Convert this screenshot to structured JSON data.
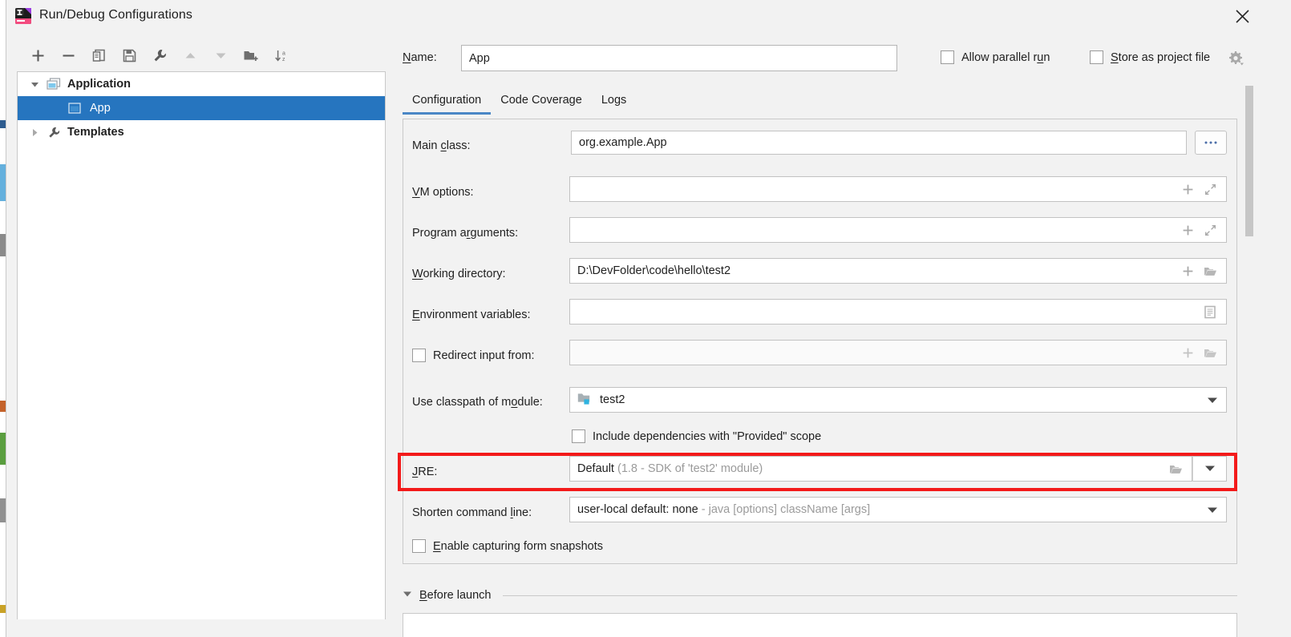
{
  "window": {
    "title": "Run/Debug Configurations",
    "app_icon": "intellij-idea-icon",
    "close_icon": "close-icon"
  },
  "toolbar": {
    "buttons": [
      {
        "name": "add-configuration-button",
        "icon": "plus-icon",
        "tooltip": "Add New Configuration",
        "enabled": true
      },
      {
        "name": "remove-configuration-button",
        "icon": "minus-icon",
        "tooltip": "Remove Configuration",
        "enabled": true
      },
      {
        "name": "copy-configuration-button",
        "icon": "copy-icon",
        "tooltip": "Copy Configuration",
        "enabled": true
      },
      {
        "name": "save-configuration-button",
        "icon": "save-icon",
        "tooltip": "Save Configuration",
        "enabled": true
      },
      {
        "name": "edit-templates-button",
        "icon": "wrench-icon",
        "tooltip": "Edit Templates",
        "enabled": true
      },
      {
        "name": "move-up-button",
        "icon": "triangle-up-icon",
        "tooltip": "Move Up",
        "enabled": false
      },
      {
        "name": "move-down-button",
        "icon": "triangle-down-icon",
        "tooltip": "Move Down",
        "enabled": false
      },
      {
        "name": "new-folder-button",
        "icon": "new-folder-icon",
        "tooltip": "Create New Folder",
        "enabled": true
      },
      {
        "name": "sort-configurations-button",
        "icon": "sort-alphabetical-icon",
        "tooltip": "Sort Configurations",
        "enabled": true
      }
    ]
  },
  "tree": {
    "items": [
      {
        "label": "Application",
        "icon": "application-icon",
        "twisty": "expanded",
        "bold": true,
        "selected": false,
        "indent": false
      },
      {
        "label": "App",
        "icon": "application-icon",
        "twisty": "none",
        "bold": false,
        "selected": true,
        "indent": true
      },
      {
        "label": "Templates",
        "icon": "wrench-icon",
        "twisty": "collapsed",
        "bold": true,
        "selected": false,
        "indent": false
      }
    ]
  },
  "header": {
    "name_label": "Name:",
    "name_value": "App",
    "name_placeholder": "",
    "allow_parallel_run": {
      "label": "Allow parallel run",
      "checked": false
    },
    "store_as_project_file": {
      "label": "Store as project file",
      "checked": false
    },
    "gear_icon": "gear-dropdown-icon"
  },
  "tabs": [
    {
      "label": "Configuration",
      "active": true
    },
    {
      "label": "Code Coverage",
      "active": false
    },
    {
      "label": "Logs",
      "active": false
    }
  ],
  "form": {
    "main_class": {
      "label": "Main class:",
      "value": "org.example.App",
      "browse_label": "...",
      "browse_icon": "ellipsis-icon"
    },
    "vm_options": {
      "label": "VM options:",
      "value": "",
      "icons": [
        "plus-icon",
        "expand-icon"
      ]
    },
    "program_arguments": {
      "label": "Program arguments:",
      "value": "",
      "icons": [
        "plus-icon",
        "expand-icon"
      ]
    },
    "working_directory": {
      "label": "Working directory:",
      "value": "D:\\DevFolder\\code\\hello\\test2",
      "icons": [
        "plus-icon",
        "folder-icon"
      ]
    },
    "environment_variables": {
      "label": "Environment variables:",
      "value": "",
      "icons": [
        "list-icon"
      ]
    },
    "redirect_input_from": {
      "label": "Redirect input from:",
      "checked": false,
      "value": "",
      "icons": [
        "plus-icon",
        "folder-icon"
      ],
      "disabled": true
    },
    "use_classpath_of_module": {
      "label": "Use classpath of module:",
      "value": "test2",
      "module_icon": "module-folder-icon",
      "icons": [
        "chevron-down-icon"
      ]
    },
    "include_provided_scope": {
      "label": "Include dependencies with \"Provided\" scope",
      "checked": false
    },
    "jre": {
      "label": "JRE:",
      "value_strong": "Default",
      "value_dim": "(1.8 - SDK of 'test2' module)",
      "icons": [
        "folder-icon",
        "chevron-down-icon"
      ],
      "highlighted": true,
      "highlight_color": "#f31a1a"
    },
    "shorten_command_line": {
      "label": "Shorten command line:",
      "value_strong": "user-local default: none",
      "value_dim": "- java [options] className [args]",
      "icons": [
        "chevron-down-icon"
      ]
    },
    "enable_capturing_form_snapshots": {
      "label": "Enable capturing form snapshots",
      "checked": false
    }
  },
  "before_launch": {
    "label": "Before launch",
    "twisty": "expanded"
  },
  "colors": {
    "selection_blue": "#2675bf",
    "tab_indicator": "#4a87c6",
    "highlight_red": "#f31a1a",
    "dialog_bg": "#f2f2f2",
    "field_bg": "#ffffff",
    "dim_text": "#9b9b9b"
  }
}
